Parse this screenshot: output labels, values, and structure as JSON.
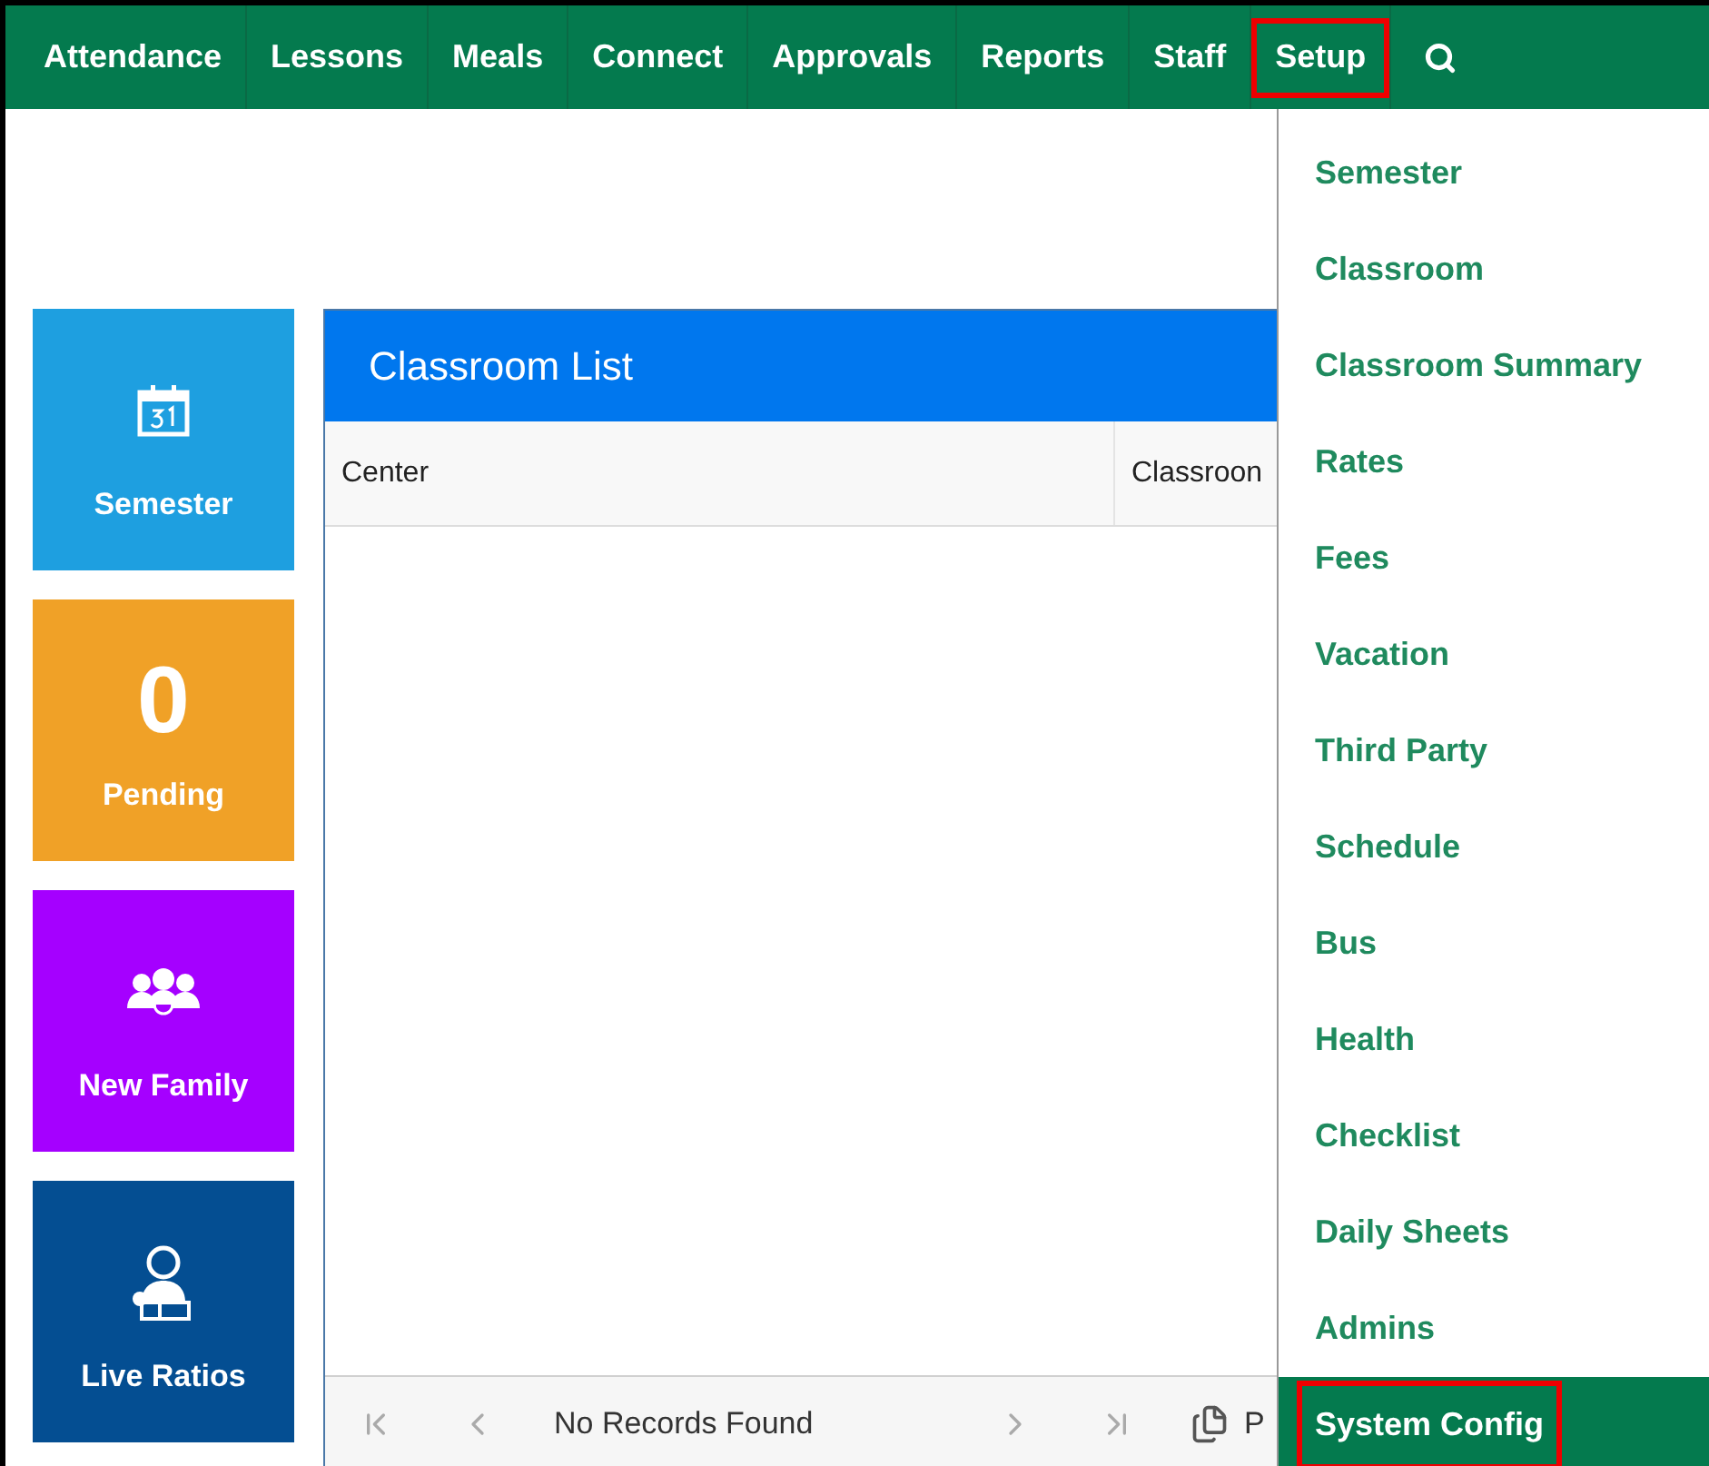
{
  "nav": {
    "items": [
      {
        "label": "Attendance",
        "highlighted": false
      },
      {
        "label": "Lessons",
        "highlighted": false
      },
      {
        "label": "Meals",
        "highlighted": false
      },
      {
        "label": "Connect",
        "highlighted": false
      },
      {
        "label": "Approvals",
        "highlighted": false
      },
      {
        "label": "Reports",
        "highlighted": false
      },
      {
        "label": "Staff",
        "highlighted": false
      },
      {
        "label": "Setup",
        "highlighted": true
      }
    ]
  },
  "tiles": [
    {
      "kind": "calendar",
      "label": "Semester",
      "color": "#1e9fe0"
    },
    {
      "kind": "count",
      "value": "0",
      "label": "Pending",
      "color": "#f0a127"
    },
    {
      "kind": "family",
      "label": "New Family",
      "color": "#a500ff"
    },
    {
      "kind": "teacher",
      "label": "Live Ratios",
      "color": "#044e92"
    }
  ],
  "panel": {
    "title": "Classroom List",
    "columns": [
      "Center",
      "Classroon"
    ],
    "pager": {
      "status": "No Records Found",
      "page_size_label": "P"
    }
  },
  "dropdown": {
    "items": [
      {
        "label": "Semester",
        "selected": false,
        "highlighted": false
      },
      {
        "label": "Classroom",
        "selected": false,
        "highlighted": false
      },
      {
        "label": "Classroom Summary",
        "selected": false,
        "highlighted": false
      },
      {
        "label": "Rates",
        "selected": false,
        "highlighted": false
      },
      {
        "label": "Fees",
        "selected": false,
        "highlighted": false
      },
      {
        "label": "Vacation",
        "selected": false,
        "highlighted": false
      },
      {
        "label": "Third Party",
        "selected": false,
        "highlighted": false
      },
      {
        "label": "Schedule",
        "selected": false,
        "highlighted": false
      },
      {
        "label": "Bus",
        "selected": false,
        "highlighted": false
      },
      {
        "label": "Health",
        "selected": false,
        "highlighted": false
      },
      {
        "label": "Checklist",
        "selected": false,
        "highlighted": false
      },
      {
        "label": "Daily Sheets",
        "selected": false,
        "highlighted": false
      },
      {
        "label": "Admins",
        "selected": false,
        "highlighted": false
      },
      {
        "label": "System Config",
        "selected": true,
        "highlighted": true
      }
    ]
  }
}
